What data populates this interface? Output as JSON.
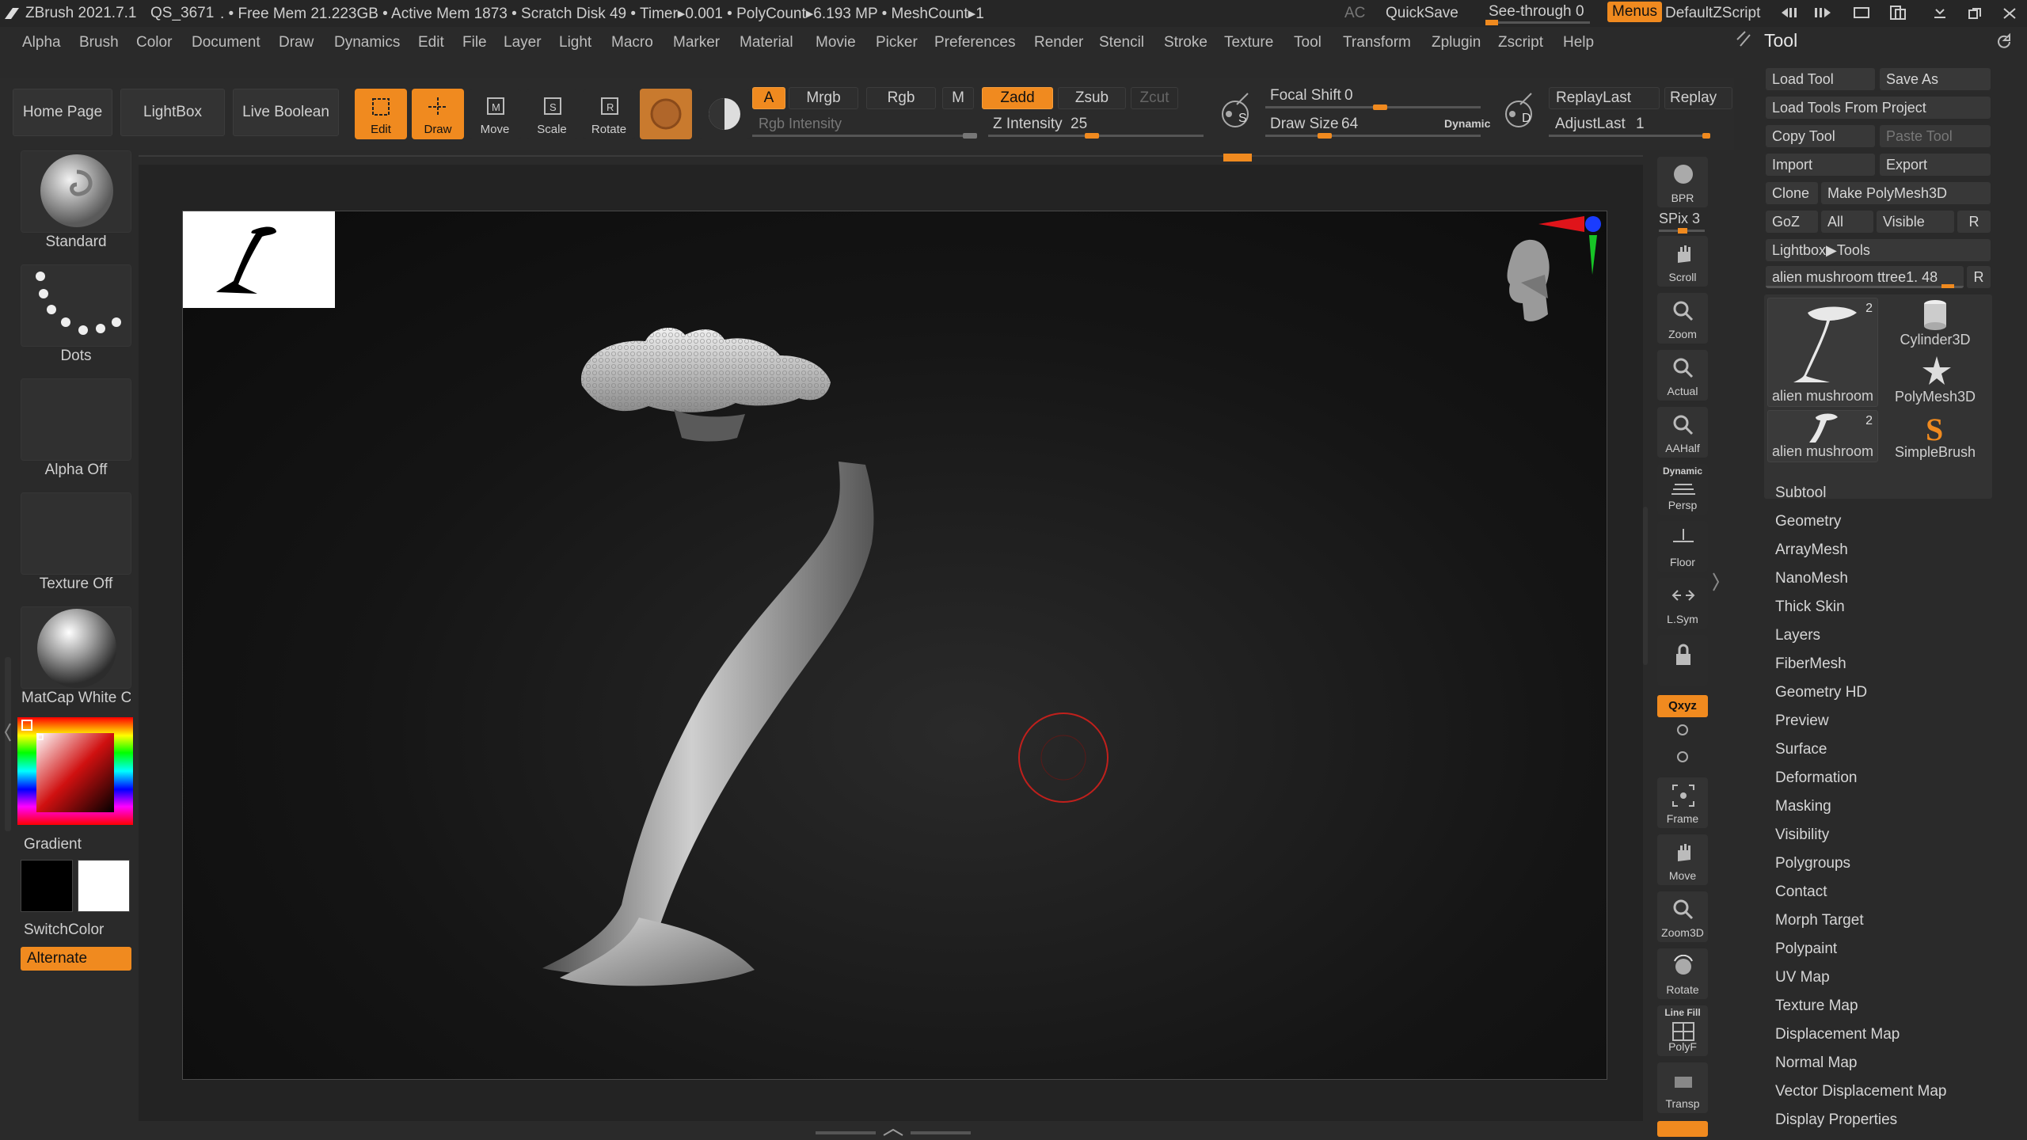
{
  "titlebar": {
    "app": "ZBrush 2021.7.1",
    "project": "QS_3671",
    "stats": ". • Free Mem 21.223GB • Active Mem 1873 • Scratch Disk 49 • Timer▸0.001 • PolyCount▸6.193 MP • MeshCount▸1",
    "ac": "AC",
    "quicksave": "QuickSave",
    "seethrough_label": "See-through",
    "seethrough_value": "0",
    "menus": "Menus",
    "script": "DefaultZScript"
  },
  "menubar": [
    "Alpha",
    "Brush",
    "Color",
    "Document",
    "Draw",
    "Dynamics",
    "Edit",
    "File",
    "Layer",
    "Light",
    "Macro",
    "Marker",
    "Material",
    "Movie",
    "Picker",
    "Preferences",
    "Render",
    "Stencil",
    "Stroke",
    "Texture",
    "Tool",
    "Transform",
    "Zplugin",
    "Zscript",
    "Help"
  ],
  "shelf": {
    "home": "Home Page",
    "lightbox": "LightBox",
    "live_boolean": "Live Boolean",
    "edit": "Edit",
    "draw": "Draw",
    "move": "Move",
    "scale": "Scale",
    "rotate": "Rotate",
    "a": "A",
    "mrgb": "Mrgb",
    "rgb": "Rgb",
    "m": "M",
    "zadd": "Zadd",
    "zsub": "Zsub",
    "zcut": "Zcut",
    "rgb_intensity": "Rgb Intensity",
    "z_intensity_label": "Z Intensity",
    "z_intensity_value": "25",
    "focal_shift_label": "Focal Shift",
    "focal_shift_value": "0",
    "draw_size_label": "Draw Size",
    "draw_size_value": "64",
    "dynamic": "Dynamic",
    "replay_last": "ReplayLast",
    "replay": "Replay",
    "adjust_last_label": "AdjustLast",
    "adjust_last_value": "1",
    "s": "S",
    "d": "D"
  },
  "left": {
    "standard": "Standard",
    "dots": "Dots",
    "alpha_off": "Alpha Off",
    "texture_off": "Texture Off",
    "matcap": "MatCap White C",
    "gradient": "Gradient",
    "switchcolor": "SwitchColor",
    "alternate": "Alternate"
  },
  "righttools": {
    "bpr": "BPR",
    "spix_label": "SPix",
    "spix_value": "3",
    "scroll": "Scroll",
    "zoom": "Zoom",
    "actual": "Actual",
    "aahalf": "AAHalf",
    "dynamic": "Dynamic",
    "persp": "Persp",
    "floor": "Floor",
    "lsym": "L.Sym",
    "xyz": "Qxyz",
    "frame": "Frame",
    "move": "Move",
    "zoom3d": "Zoom3D",
    "rotate": "Rotate",
    "linefill": "Line Fill",
    "polyf": "PolyF",
    "transp": "Transp"
  },
  "tool": {
    "title": "Tool",
    "load_tool": "Load Tool",
    "save_as": "Save As",
    "load_from_project": "Load Tools From Project",
    "copy_tool": "Copy Tool",
    "paste_tool": "Paste Tool",
    "import": "Import",
    "export": "Export",
    "clone": "Clone",
    "make_polymesh": "Make PolyMesh3D",
    "goz": "GoZ",
    "all": "All",
    "visible": "Visible",
    "r": "R",
    "lightbox_tools": "Lightbox▶Tools",
    "current_tool": "alien mushroom ttree1. 48",
    "thumbs": [
      {
        "label": "alien mushroom",
        "count": "2"
      },
      {
        "label": "Cylinder3D",
        "count": ""
      },
      {
        "label": "PolyMesh3D",
        "count": ""
      },
      {
        "label": "alien mushroom",
        "count": "2"
      },
      {
        "label": "SimpleBrush",
        "count": ""
      }
    ],
    "sections": [
      "Subtool",
      "Geometry",
      "ArrayMesh",
      "NanoMesh",
      "Thick Skin",
      "Layers",
      "FiberMesh",
      "Geometry HD",
      "Preview",
      "Surface",
      "Deformation",
      "Masking",
      "Visibility",
      "Polygroups",
      "Contact",
      "Morph Target",
      "Polypaint",
      "UV Map",
      "Texture Map",
      "Displacement Map",
      "Normal Map",
      "Vector Displacement Map",
      "Display Properties"
    ]
  },
  "colors": {
    "accent": "#f08a1f",
    "panel": "#2a2a2a",
    "brush_cursor": "#c0201c"
  }
}
